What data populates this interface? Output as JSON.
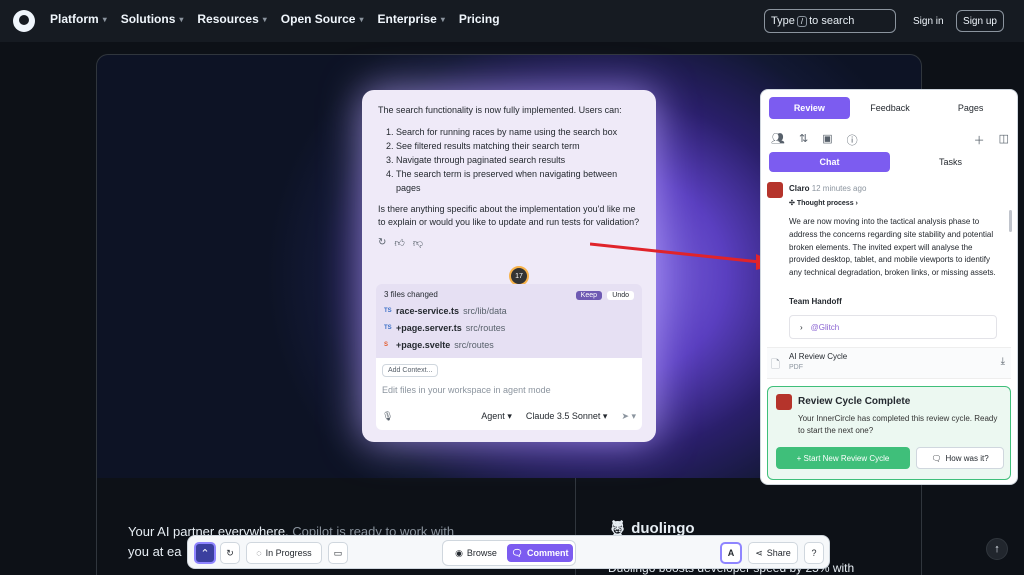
{
  "nav": {
    "items": [
      {
        "label": "Platform",
        "dropdown": true
      },
      {
        "label": "Solutions",
        "dropdown": true
      },
      {
        "label": "Resources",
        "dropdown": true
      },
      {
        "label": "Open Source",
        "dropdown": true
      },
      {
        "label": "Enterprise",
        "dropdown": true
      },
      {
        "label": "Pricing",
        "dropdown": false
      }
    ],
    "search_pre": "Type",
    "search_key": "/",
    "search_post": "to search",
    "signin": "Sign in",
    "signup": "Sign up"
  },
  "copilot": {
    "intro": "The search functionality is now fully implemented. Users can:",
    "list": [
      "Search for running races by name using the search box",
      "See filtered results matching their search term",
      "Navigate through paginated search results",
      "The search term is preserved when navigating between pages"
    ],
    "question": "Is there anything specific about the implementation you'd like me to explain or would you like to update and run tests for validation?",
    "bubble": "17",
    "files_changed": "3 files changed",
    "keep": "Keep",
    "undo": "Undo",
    "files": [
      {
        "ext": "TS",
        "name": "race-service.ts",
        "path": "src/lib/data"
      },
      {
        "ext": "TS",
        "name": "+page.server.ts",
        "path": "src/routes"
      },
      {
        "ext": "S",
        "name": "+page.svelte",
        "path": "src/routes"
      }
    ],
    "add_context": "Add Context...",
    "placeholder": "Edit files in your workspace in agent mode",
    "agent": "Agent",
    "model": "Claude 3.5 Sonnet"
  },
  "panel": {
    "tabs": [
      "Review",
      "Feedback",
      "Pages"
    ],
    "subtabs": [
      "Chat",
      "Tasks"
    ],
    "sender": "Claro",
    "time": "12 minutes ago",
    "thought": "Thought process",
    "body": "We are now moving into the tactical analysis phase to address the concerns regarding site stability and potential broken elements. The invited expert will analyse the provided desktop, tablet, and mobile viewports to identify any technical degradation, broken links, or missing assets.",
    "handoff": "Team Handoff",
    "glitch": "@Glitch",
    "pdf_title": "AI Review Cycle",
    "pdf_type": "PDF",
    "complete_title": "Review Cycle Complete",
    "complete_body": "Your InnerCircle has completed this review cycle. Ready to start the next one?",
    "start_btn": "+ Start New Review Cycle",
    "how_btn": "How was it?"
  },
  "lower": {
    "partner_strong": "Your AI partner everywhere.",
    "partner_dim": "Copilot is ready to work with",
    "partner_line2": "you at ea",
    "duolingo": "duolingo",
    "duo_sub": "Duolingo boosts developer speed by 25% with"
  },
  "toolbar": {
    "in_progress": "In Progress",
    "browse": "Browse",
    "comment": "Comment",
    "share": "Share"
  },
  "colors": {
    "accent": "#7c5cf0",
    "success": "#3fbf7a",
    "arrow": "#e0232a"
  }
}
